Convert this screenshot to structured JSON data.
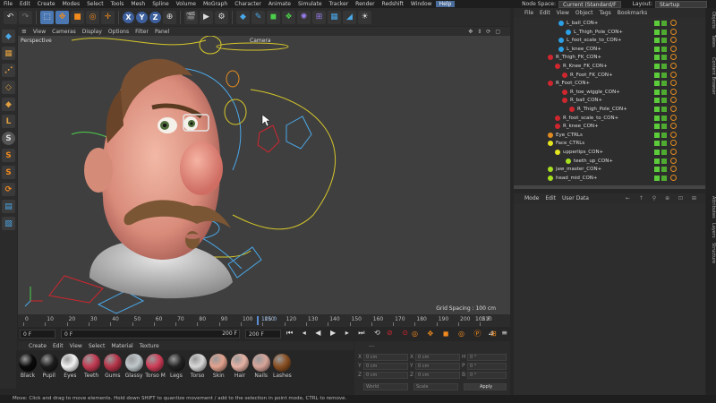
{
  "menubar": {
    "items": [
      "File",
      "Edit",
      "Create",
      "Modes",
      "Select",
      "Tools",
      "Mesh",
      "Spline",
      "Volume",
      "MoGraph",
      "Character",
      "Animate",
      "Simulate",
      "Tracker",
      "Render",
      "Redshift",
      "Window",
      "Help"
    ],
    "node_space_label": "Node Space:",
    "node_space_value": "Current (Standard/F",
    "layout_label": "Layout:",
    "layout_value": "Startup"
  },
  "toolbar": {
    "axis_x": "X",
    "axis_y": "Y",
    "axis_z": "Z"
  },
  "lefttools": {
    "s1": "S",
    "s2": "S",
    "s3": "S"
  },
  "viewport": {
    "menu": [
      "View",
      "Cameras",
      "Display",
      "Options",
      "Filter",
      "Panel"
    ],
    "projection": "Perspective",
    "camera": "Camera",
    "grid_spacing": "Grid Spacing : 100 cm"
  },
  "timeline": {
    "ticks": [
      "0",
      "10",
      "20",
      "30",
      "40",
      "50",
      "60",
      "70",
      "80",
      "90",
      "100",
      "110",
      "120",
      "130",
      "140",
      "150",
      "160",
      "170",
      "180",
      "190",
      "200",
      "210"
    ],
    "current_marker": "105 0",
    "frame_readout": "105 F",
    "start_field": "0 F",
    "start2_field": "0 F",
    "end_field": "200 F",
    "end2_field": "200 F"
  },
  "materials": {
    "menu": [
      "Create",
      "Edit",
      "View",
      "Select",
      "Material",
      "Texture"
    ],
    "items": [
      {
        "name": "Black",
        "color": "#0a0a0a"
      },
      {
        "name": "Pupil",
        "color": "#1c1c1c"
      },
      {
        "name": "Eyes",
        "color": "#f2f2f2"
      },
      {
        "name": "Teeth",
        "color": "#c23a52"
      },
      {
        "name": "Gums",
        "color": "#b53348"
      },
      {
        "name": "Glassy",
        "color": "#c0c8cc"
      },
      {
        "name": "Torso M",
        "color": "#cf3d58"
      },
      {
        "name": "Legs",
        "color": "#222"
      },
      {
        "name": "Torso",
        "color": "#d8d8d8"
      },
      {
        "name": "Skin",
        "color": "#e3a28e"
      },
      {
        "name": "Hair",
        "color": "#e6b3a5"
      },
      {
        "name": "Nails",
        "color": "#d7a59a"
      },
      {
        "name": "Lashes",
        "color": "#8a4f22"
      }
    ]
  },
  "coords": {
    "header": "---",
    "rows": [
      {
        "axis": "X",
        "pos": "0 cm",
        "size": "0 cm",
        "rot_label": "H",
        "rot": "0 °"
      },
      {
        "axis": "Y",
        "pos": "0 cm",
        "size": "0 cm",
        "rot_label": "P",
        "rot": "0 °"
      },
      {
        "axis": "Z",
        "pos": "0 cm",
        "size": "0 cm",
        "rot_label": "B",
        "rot": "0 °"
      }
    ],
    "mode1": "World",
    "mode2": "Scale",
    "apply": "Apply"
  },
  "objects": {
    "menu": [
      "File",
      "Edit",
      "View",
      "Object",
      "Tags",
      "Bookmarks"
    ],
    "rows": [
      {
        "name": "L_ball_CON+",
        "color": "#2ca0e6",
        "indent": 50
      },
      {
        "name": "L_Thigh_Pole_CON+",
        "color": "#2ca0e6",
        "indent": 58
      },
      {
        "name": "L_foot_scale_to_CON+",
        "color": "#2ca0e6",
        "indent": 50
      },
      {
        "name": "L_knee_CON+",
        "color": "#2ca0e6",
        "indent": 50
      },
      {
        "name": "R_Thigh_FK_CON+",
        "color": "#d0262e",
        "indent": 38
      },
      {
        "name": "R_Knee_FK_CON+",
        "color": "#d0262e",
        "indent": 46
      },
      {
        "name": "R_Foot_FK_CON+",
        "color": "#d0262e",
        "indent": 54
      },
      {
        "name": "R_Foot_CON+",
        "color": "#d0262e",
        "indent": 38
      },
      {
        "name": "R_toe_wiggle_CON+",
        "color": "#d0262e",
        "indent": 54
      },
      {
        "name": "R_ball_CON+",
        "color": "#d0262e",
        "indent": 54
      },
      {
        "name": "R_Thigh_Pole_CON+",
        "color": "#d0262e",
        "indent": 62
      },
      {
        "name": "R_foot_scale_to_CON+",
        "color": "#d0262e",
        "indent": 46
      },
      {
        "name": "R_knee_CON+",
        "color": "#d0262e",
        "indent": 46
      },
      {
        "name": "Eye_CTRLs",
        "color": "#e28b20",
        "indent": 38
      },
      {
        "name": "Face_CTRLs",
        "color": "#e5e520",
        "indent": 38
      },
      {
        "name": "upperlips_CON+",
        "color": "#e5e520",
        "indent": 46
      },
      {
        "name": "teeth_up_CON+",
        "color": "#a6e020",
        "indent": 58
      },
      {
        "name": "jaw_master_CON+",
        "color": "#a6e020",
        "indent": 38
      },
      {
        "name": "head_mid_CON+",
        "color": "#a6e020",
        "indent": 38
      }
    ]
  },
  "attributes": {
    "menu": [
      "Mode",
      "Edit",
      "User Data"
    ]
  },
  "side_tabs": [
    "Objects",
    "Takes",
    "Content Browser",
    "Attributes",
    "Layers",
    "Structure"
  ],
  "status": "Move: Click and drag to move elements. Hold down SHIFT to quantize movement / add to the selection in point mode, CTRL to remove."
}
